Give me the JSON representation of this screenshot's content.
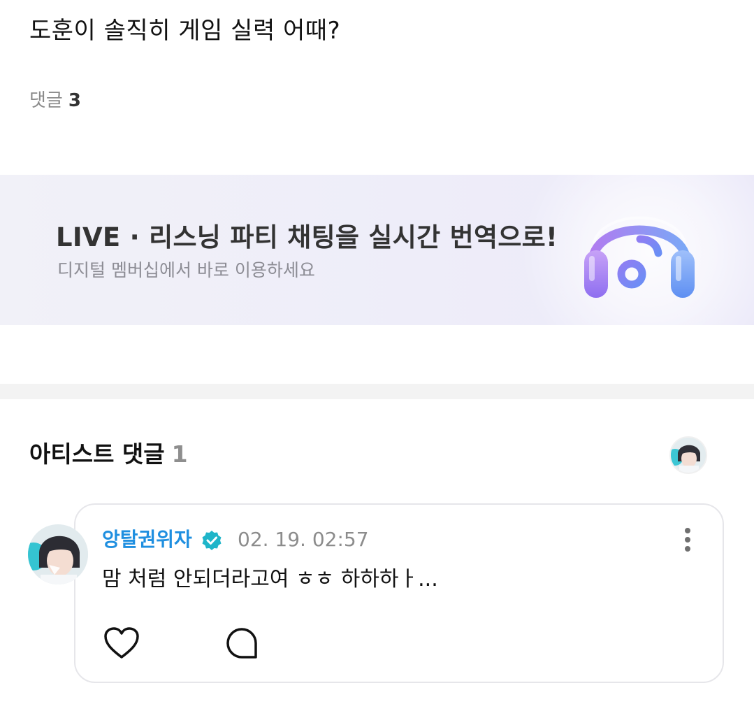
{
  "post": {
    "title": "도훈이 솔직히 게임 실력 어때?",
    "comment_label": "댓글",
    "comment_count": "3"
  },
  "banner": {
    "title": "LIVE · 리스닝 파티 채팅을 실시간 번역으로!",
    "subtitle": "디지털 멤버십에서 바로 이용하세요",
    "icon": "headphones-music-icon"
  },
  "artist_comments": {
    "heading": "아티스트 댓글",
    "count": "1",
    "header_avatar_icon": "artist-avatar",
    "items": [
      {
        "author": "앙탈권위자",
        "verified": true,
        "time": "02. 19. 02:57",
        "text": "맘 처럼 안되더라고여 ㅎㅎ 하하하ㅏ...",
        "actions": [
          "heart-icon",
          "reply-bubble-icon",
          "more-vertical-icon"
        ]
      }
    ]
  },
  "colors": {
    "author_blue": "#1f8fe0",
    "verified_teal": "#1fb5c9",
    "banner_bg": "#eeedf9",
    "divider": "#f3f3f3"
  }
}
